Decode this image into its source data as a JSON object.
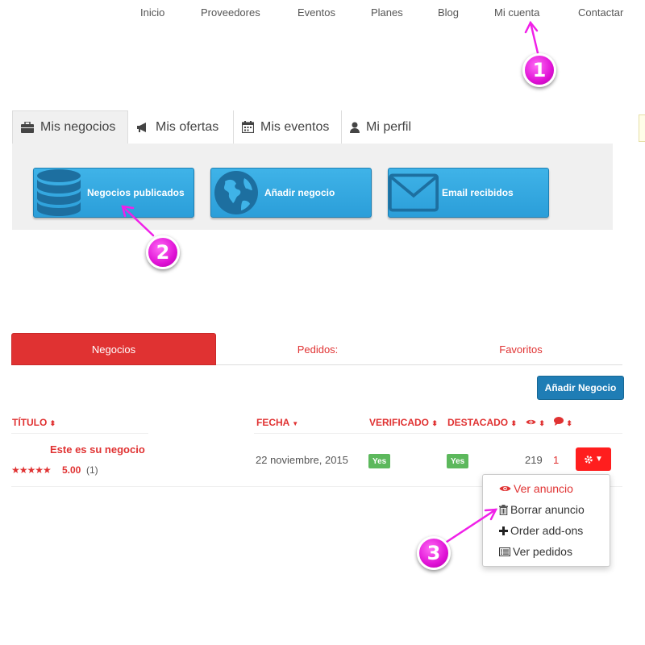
{
  "nav": {
    "items": [
      "Inicio",
      "Proveedores",
      "Eventos",
      "Planes",
      "Blog",
      "Mi cuenta",
      "Contactar"
    ]
  },
  "account_tabs": [
    {
      "label": "Mis negocios",
      "icon": "briefcase-icon",
      "active": true
    },
    {
      "label": "Mis ofertas",
      "icon": "megaphone-icon",
      "active": false
    },
    {
      "label": "Mis eventos",
      "icon": "calendar-icon",
      "active": false
    },
    {
      "label": "Mi perfil",
      "icon": "user-icon",
      "active": false
    }
  ],
  "action_buttons": [
    {
      "label": "Negocios publicados",
      "icon": "database-icon"
    },
    {
      "label": "Añadir negocio",
      "icon": "globe-icon"
    },
    {
      "label": "Email recibidos",
      "icon": "envelope-icon"
    }
  ],
  "markers": [
    "1",
    "2",
    "3"
  ],
  "listing_tabs": [
    {
      "label": "Negocios",
      "active": true
    },
    {
      "label": "Pedidos:",
      "active": false
    },
    {
      "label": "Favoritos",
      "active": false
    }
  ],
  "add_business_label": "Añadir Negocio",
  "table": {
    "headers": {
      "title": "TÍTULO",
      "date": "FECHA",
      "verified": "VERIFICADO",
      "featured": "DESTACADO"
    },
    "row": {
      "title": "Este es su negocio",
      "stars": "★★★★★",
      "rating": "5.00",
      "rating_count": "(1)",
      "date": "22 noviembre, 2015",
      "verified": "Yes",
      "featured": "Yes",
      "views": "219",
      "comments": "1"
    }
  },
  "dropdown": {
    "items": [
      {
        "label": "Ver anuncio",
        "icon": "eye-icon"
      },
      {
        "label": "Borrar anuncio",
        "icon": "trash-icon"
      },
      {
        "label": "Order add-ons",
        "icon": "plus-icon"
      },
      {
        "label": "Ver pedidos",
        "icon": "list-icon"
      }
    ]
  },
  "colors": {
    "accent_red": "#e03232",
    "button_blue": "#2b9ed9",
    "marker_magenta": "#e012d6",
    "badge_green": "#5cb85c"
  }
}
